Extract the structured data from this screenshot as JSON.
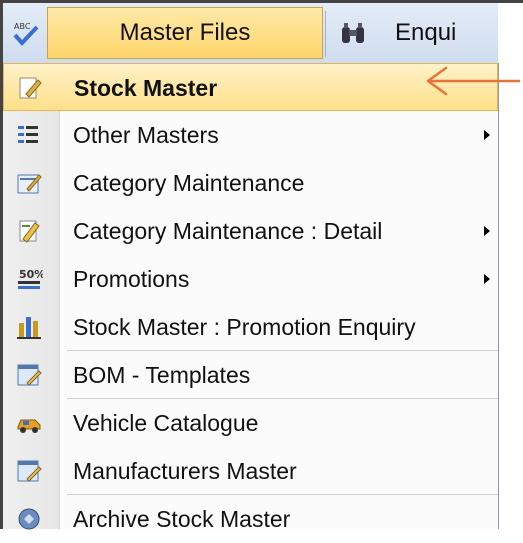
{
  "menubar": {
    "master_label": "Master Files",
    "enquiry_label": "Enqui"
  },
  "menu": {
    "items": [
      {
        "label": "Stock Master",
        "icon": "edit-page-icon",
        "submenu": false,
        "selected": true
      },
      {
        "label": "Other Masters",
        "icon": "list-icon",
        "submenu": true
      },
      {
        "label": "Category Maintenance",
        "icon": "edit-form-icon",
        "submenu": false
      },
      {
        "label": "Category Maintenance : Detail",
        "icon": "pencil-page-icon",
        "submenu": true
      },
      {
        "label": "Promotions",
        "icon": "percent-tag-icon",
        "submenu": true
      },
      {
        "label": "Stock Master : Promotion Enquiry",
        "icon": "bar-chart-icon",
        "submenu": false
      },
      {
        "label": "BOM - Templates",
        "icon": "template-edit-icon",
        "submenu": false
      },
      {
        "label": "Vehicle Catalogue",
        "icon": "vehicle-icon",
        "submenu": false
      },
      {
        "label": "Manufacturers Master",
        "icon": "template-edit-icon",
        "submenu": false
      },
      {
        "label": "Archive Stock Master",
        "icon": "archive-icon",
        "submenu": false
      }
    ]
  },
  "colors": {
    "selected_bg": "#ffe08a",
    "menubar_bg": "#cfdcee",
    "annotation_arrow": "#e8733a"
  }
}
